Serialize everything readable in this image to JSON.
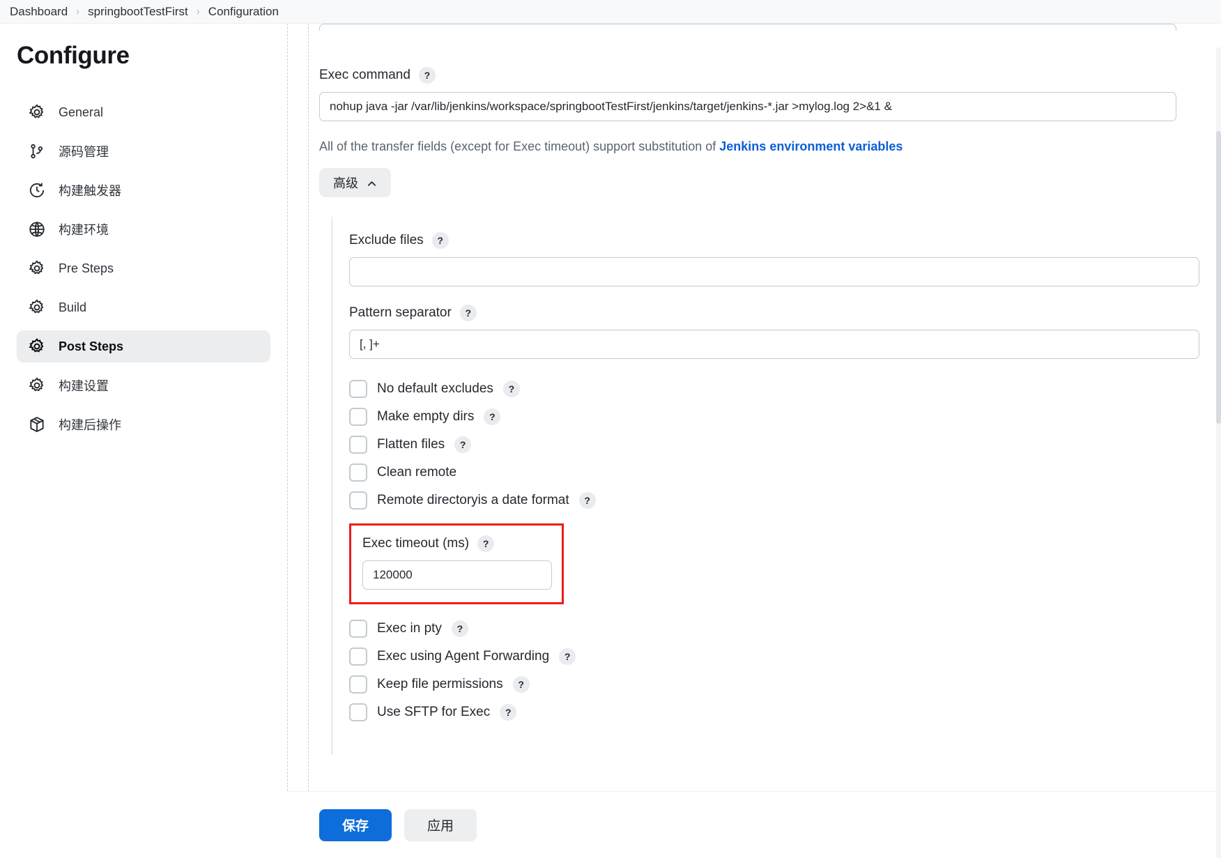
{
  "breadcrumb": {
    "items": [
      {
        "label": "Dashboard"
      },
      {
        "label": "springbootTestFirst"
      },
      {
        "label": "Configuration"
      }
    ],
    "separator": "›"
  },
  "sidebar": {
    "title": "Configure",
    "items": [
      {
        "label": "General",
        "icon": "gear-icon",
        "active": false
      },
      {
        "label": "源码管理",
        "icon": "branch-icon",
        "active": false
      },
      {
        "label": "构建触发器",
        "icon": "clock-icon",
        "active": false
      },
      {
        "label": "构建环境",
        "icon": "globe-icon",
        "active": false
      },
      {
        "label": "Pre Steps",
        "icon": "gear-icon",
        "active": false
      },
      {
        "label": "Build",
        "icon": "gear-icon",
        "active": false
      },
      {
        "label": "Post Steps",
        "icon": "gear-icon",
        "active": true
      },
      {
        "label": "构建设置",
        "icon": "gear-icon",
        "active": false
      },
      {
        "label": "构建后操作",
        "icon": "box-icon",
        "active": false
      }
    ]
  },
  "form": {
    "exec_command": {
      "label": "Exec command",
      "help": "?",
      "value": "nohup java -jar /var/lib/jenkins/workspace/springbootTestFirst/jenkins/target/jenkins-*.jar >mylog.log 2>&1 &",
      "placeholder": ""
    },
    "note": {
      "text_before": "All of the transfer fields (except for Exec timeout) support substitution of ",
      "link_text": "Jenkins environment variables"
    },
    "advanced_button": {
      "label": "高级",
      "chevron": "chevron-up-icon"
    },
    "advanced": {
      "exclude_files": {
        "label": "Exclude files",
        "help": "?",
        "value": "",
        "placeholder": ""
      },
      "pattern_separator": {
        "label": "Pattern separator",
        "help": "?",
        "value": "[, ]+",
        "placeholder": ""
      },
      "checkboxes_top": [
        {
          "label": "No default excludes",
          "help": "?",
          "checked": false
        },
        {
          "label": "Make empty dirs",
          "help": "?",
          "checked": false
        },
        {
          "label": "Flatten files",
          "help": "?",
          "checked": false
        },
        {
          "label": "Clean remote",
          "help": "",
          "checked": false
        },
        {
          "label": "Remote directoryis a date format",
          "help": "?",
          "checked": false
        }
      ],
      "exec_timeout": {
        "label": "Exec timeout (ms)",
        "help": "?",
        "value": "120000",
        "placeholder": "",
        "highlighted": true,
        "highlight_color": "#ee1c1c"
      },
      "checkboxes_bottom": [
        {
          "label": "Exec in pty",
          "help": "?",
          "checked": false
        },
        {
          "label": "Exec using Agent Forwarding",
          "help": "?",
          "checked": false
        },
        {
          "label": "Keep file permissions",
          "help": "?",
          "checked": false
        },
        {
          "label": "Use SFTP for Exec",
          "help": "?",
          "checked": false
        }
      ]
    }
  },
  "footer": {
    "save_label": "保存",
    "apply_label": "应用"
  },
  "colors": {
    "primary": "#0d6ddb",
    "link": "#0b5ed7",
    "highlight": "#ee1c1c",
    "active_bg": "#ebedef"
  }
}
